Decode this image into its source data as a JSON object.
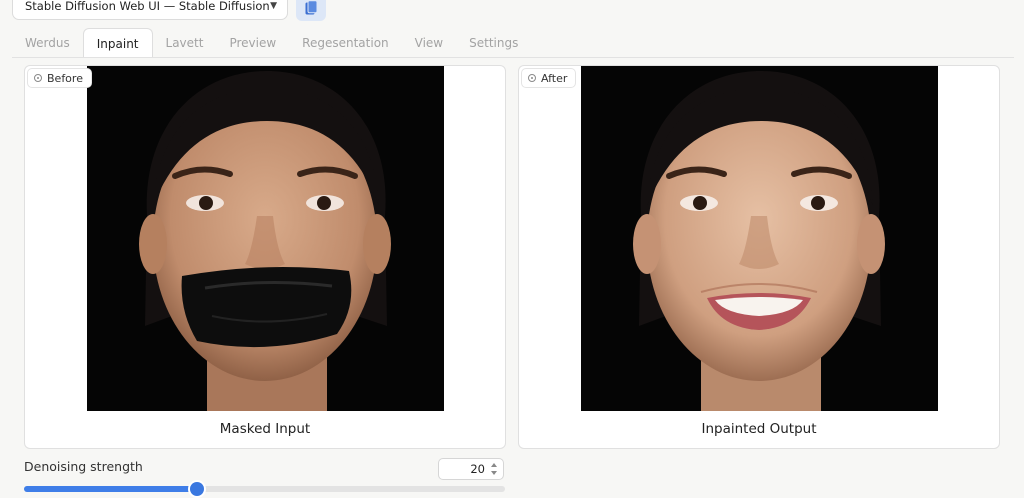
{
  "header": {
    "model_select_value": "Stable Diffusion Web UI — Stable Diffusion",
    "chevron_icon": "chevron-down-icon",
    "refresh_icon": "clipboard-icon"
  },
  "tabs": [
    {
      "label": "Werdus",
      "active": false
    },
    {
      "label": "Inpaint",
      "active": true
    },
    {
      "label": "Lavett",
      "active": false
    },
    {
      "label": "Preview",
      "active": false
    },
    {
      "label": "Regesentation",
      "active": false
    },
    {
      "label": "View",
      "active": false
    },
    {
      "label": "Settings",
      "active": false
    }
  ],
  "panels": {
    "before": {
      "tag": "Before",
      "caption": "Masked Input"
    },
    "after": {
      "tag": "After",
      "caption": "Inpainted Output"
    }
  },
  "slider": {
    "label": "Denoising strength",
    "value": "20",
    "fraction": 0.36
  },
  "colors": {
    "accent": "#3f7ee8",
    "tab_inactive": "#a3a3a3",
    "photo_background": "#050505"
  }
}
